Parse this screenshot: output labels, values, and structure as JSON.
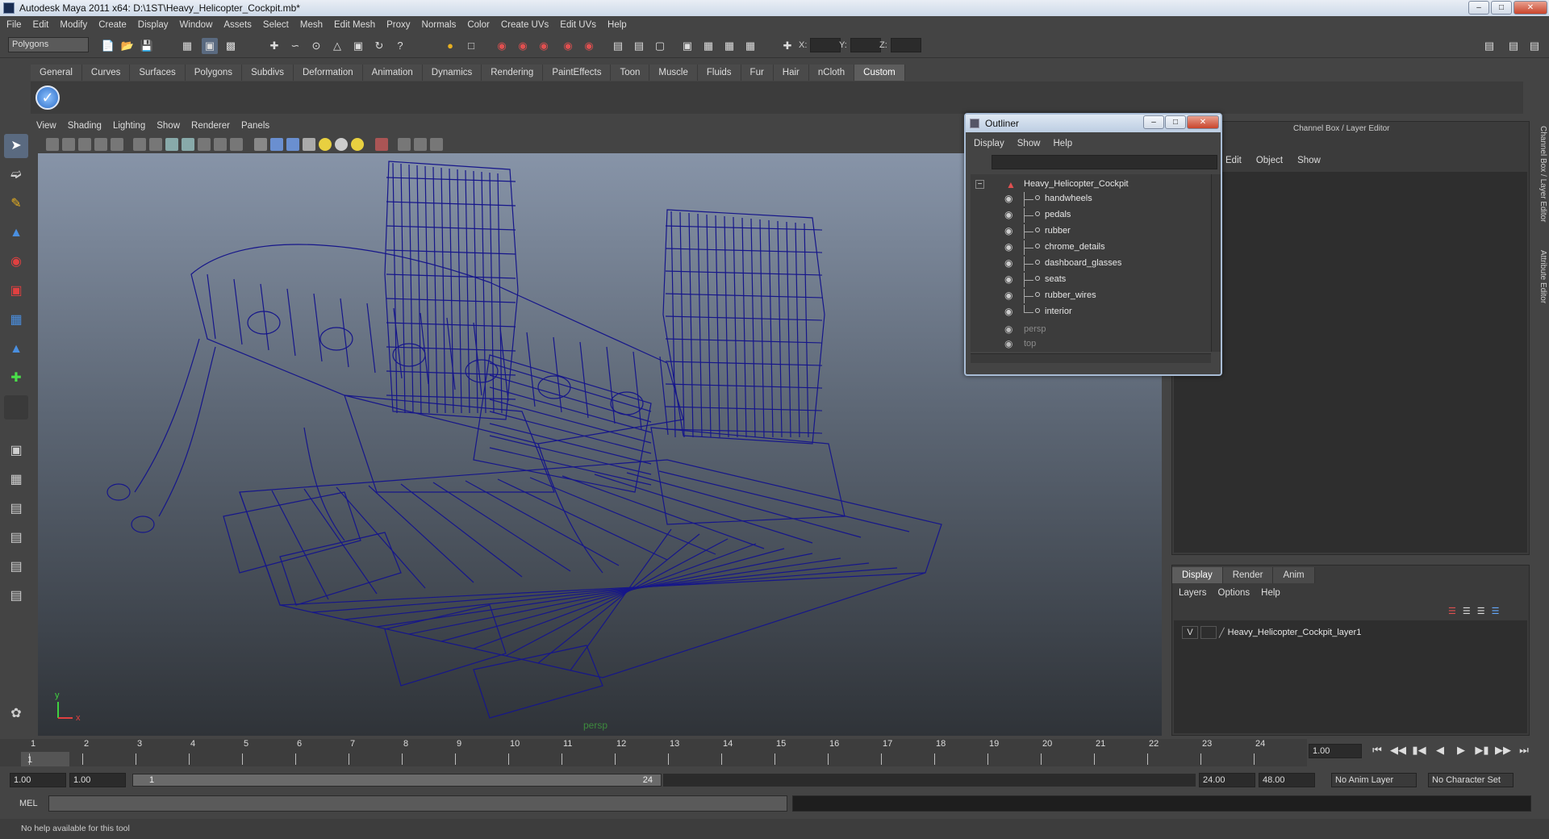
{
  "window": {
    "title": "Autodesk Maya 2011 x64: D:\\1ST\\Heavy_Helicopter_Cockpit.mb*",
    "buttons": {
      "minimize": "–",
      "maximize": "□",
      "close": "✕"
    }
  },
  "menubar": [
    "File",
    "Edit",
    "Modify",
    "Create",
    "Display",
    "Window",
    "Assets",
    "Select",
    "Mesh",
    "Edit Mesh",
    "Proxy",
    "Normals",
    "Color",
    "Create UVs",
    "Edit UVs",
    "Help"
  ],
  "toolbar": {
    "mode": "Polygons",
    "coord_x_label": "X:",
    "coord_y_label": "Y:",
    "coord_z_label": "Z:"
  },
  "shelf": {
    "tabs": [
      "General",
      "Curves",
      "Surfaces",
      "Polygons",
      "Subdivs",
      "Deformation",
      "Animation",
      "Dynamics",
      "Rendering",
      "PaintEffects",
      "Toon",
      "Muscle",
      "Fluids",
      "Fur",
      "Hair",
      "nCloth",
      "Custom"
    ],
    "active_tab": "Custom"
  },
  "viewport": {
    "menu": [
      "View",
      "Shading",
      "Lighting",
      "Show",
      "Renderer",
      "Panels"
    ],
    "camera_label": "persp",
    "axis_y": "y",
    "axis_x": "x",
    "wire_color": "#16168a"
  },
  "outliner": {
    "title": "Outliner",
    "menu": [
      "Display",
      "Show",
      "Help"
    ],
    "root": "Heavy_Helicopter_Cockpit",
    "children": [
      "handwheels",
      "pedals",
      "rubber",
      "chrome_details",
      "dashboard_glasses",
      "seats",
      "rubber_wires",
      "interior"
    ],
    "cameras": [
      "persp",
      "top"
    ]
  },
  "channel_box": {
    "header": "Channel Box / Layer Editor",
    "menu": [
      "Edit",
      "Object",
      "Show"
    ]
  },
  "side_tabs": [
    "Channel Box / Layer Editor",
    "Attribute Editor"
  ],
  "layer_editor": {
    "tabs": [
      "Display",
      "Render",
      "Anim"
    ],
    "active_tab": "Display",
    "menu": [
      "Layers",
      "Options",
      "Help"
    ],
    "layer": {
      "visible_flag": "V",
      "name": "Heavy_Helicopter_Cockpit_layer1"
    }
  },
  "timeline": {
    "frames": [
      "1",
      "2",
      "3",
      "4",
      "5",
      "6",
      "7",
      "8",
      "9",
      "10",
      "11",
      "12",
      "13",
      "14",
      "15",
      "16",
      "17",
      "18",
      "19",
      "20",
      "21",
      "22",
      "23",
      "24"
    ],
    "current_frame_marker": "1",
    "current_time": "1.00"
  },
  "range": {
    "start": "1.00",
    "anim_start": "1.00",
    "slider_start": "1",
    "slider_end": "24",
    "anim_end": "24.00",
    "end": "48.00",
    "anim_layer": "No Anim Layer",
    "character_set": "No Character Set"
  },
  "command_line": {
    "label": "MEL"
  },
  "status_line": {
    "help": "No help available for this tool"
  }
}
